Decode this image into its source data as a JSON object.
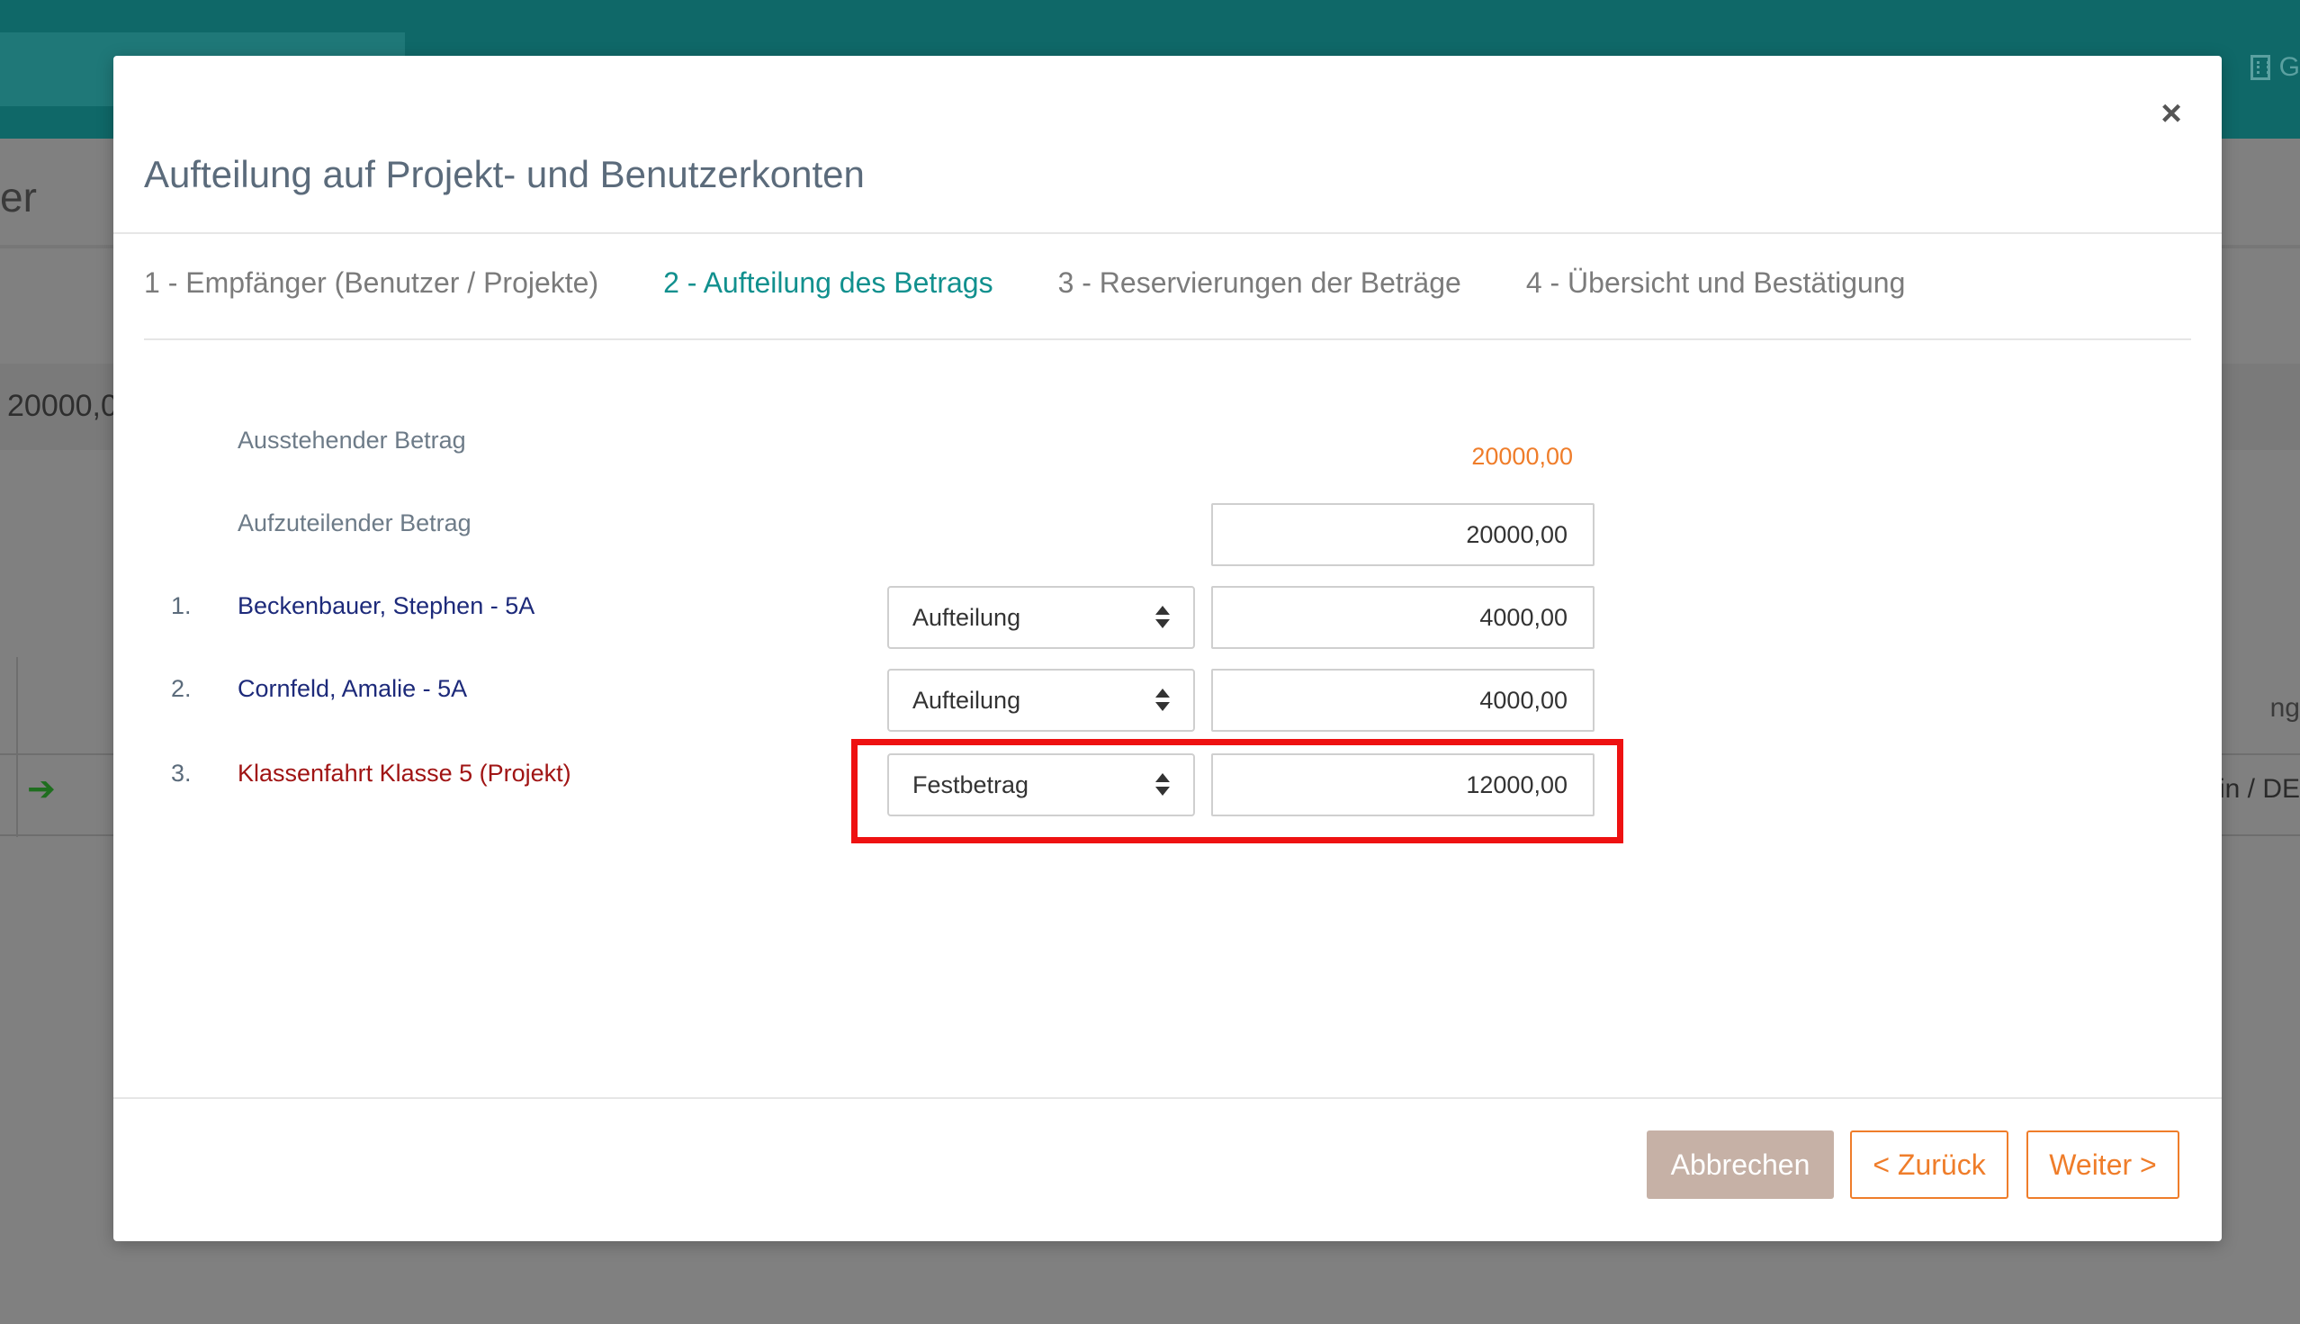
{
  "background": {
    "header_right_text": "G",
    "page_title_fragment": "er",
    "amount_fragment": "20000,0",
    "table_right_text_1": "ng",
    "table_right_text_2": "ein / DE"
  },
  "modal": {
    "title": "Aufteilung auf Projekt- und Benutzerkonten",
    "close_symbol": "×",
    "steps": [
      {
        "label": "1 - Empfänger (Benutzer / Projekte)",
        "active": false
      },
      {
        "label": "2 - Aufteilung des Betrags",
        "active": true
      },
      {
        "label": "3 - Reservierungen der Beträge",
        "active": false
      },
      {
        "label": "4 - Übersicht und Bestätigung",
        "active": false
      }
    ],
    "outstanding_label": "Ausstehender Betrag",
    "outstanding_value": "20000,00",
    "distribute_label": "Aufzuteilender Betrag",
    "distribute_value": "20000,00",
    "rows": [
      {
        "number": "1.",
        "name": "Beckenbauer, Stephen - 5A",
        "kind": "user",
        "mode": "Aufteilung",
        "amount": "4000,00"
      },
      {
        "number": "2.",
        "name": "Cornfeld, Amalie - 5A",
        "kind": "user",
        "mode": "Aufteilung",
        "amount": "4000,00"
      },
      {
        "number": "3.",
        "name": "Klassenfahrt Klasse 5 (Projekt)",
        "kind": "project",
        "mode": "Festbetrag",
        "amount": "12000,00"
      }
    ],
    "buttons": {
      "cancel": "Abbrechen",
      "back": "< Zurück",
      "next": "Weiter >"
    }
  },
  "colors": {
    "accent_teal": "#11908e",
    "accent_orange": "#ef7d2a",
    "highlight_red": "#ee1111"
  }
}
